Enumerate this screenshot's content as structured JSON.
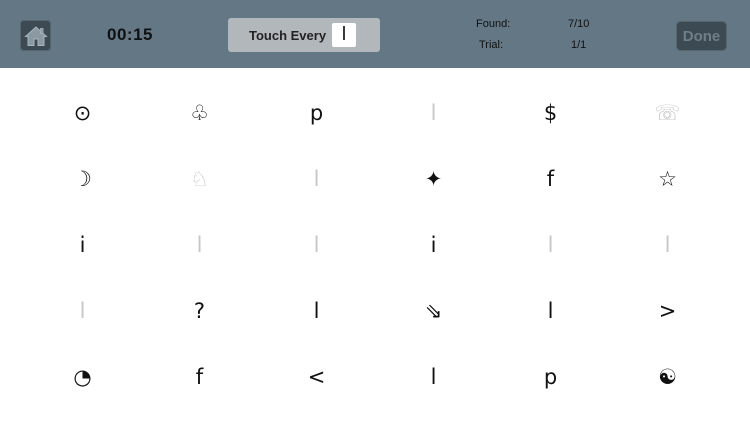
{
  "header": {
    "timer": "00:15",
    "target_label": "Touch Every",
    "target_symbol": "l",
    "found_label": "Found:",
    "found_value": "7/10",
    "trial_label": "Trial:",
    "trial_value": "1/1",
    "done_label": "Done",
    "home_icon": "home-icon"
  },
  "grid": {
    "cells": [
      {
        "symbol": "⊙",
        "faint": false
      },
      {
        "symbol": "♧",
        "faint": false
      },
      {
        "symbol": "p",
        "faint": false
      },
      {
        "symbol": "l",
        "faint": true
      },
      {
        "symbol": "$",
        "faint": false
      },
      {
        "symbol": "☏",
        "faint": true
      },
      {
        "symbol": "☽",
        "faint": false
      },
      {
        "symbol": "♘",
        "faint": true
      },
      {
        "symbol": "l",
        "faint": true
      },
      {
        "symbol": "✦",
        "faint": false
      },
      {
        "symbol": "f",
        "faint": false
      },
      {
        "symbol": "☆",
        "faint": false
      },
      {
        "symbol": "i",
        "faint": false
      },
      {
        "symbol": "l",
        "faint": true
      },
      {
        "symbol": "l",
        "faint": true
      },
      {
        "symbol": "i",
        "faint": false
      },
      {
        "symbol": "l",
        "faint": true
      },
      {
        "symbol": "l",
        "faint": true
      },
      {
        "symbol": "l",
        "faint": true
      },
      {
        "symbol": "?",
        "faint": false
      },
      {
        "symbol": "l",
        "faint": false
      },
      {
        "symbol": "⇘",
        "faint": false
      },
      {
        "symbol": "l",
        "faint": false
      },
      {
        "symbol": ">",
        "faint": false
      },
      {
        "symbol": "◔",
        "faint": false
      },
      {
        "symbol": "f",
        "faint": false
      },
      {
        "symbol": "<",
        "faint": false
      },
      {
        "symbol": "l",
        "faint": false
      },
      {
        "symbol": "p",
        "faint": false
      },
      {
        "symbol": "☯",
        "faint": false
      }
    ]
  },
  "colors": {
    "header_bg": "#637884",
    "button_bg": "#3b4a53",
    "faint_symbol": "#c7c7c7"
  }
}
